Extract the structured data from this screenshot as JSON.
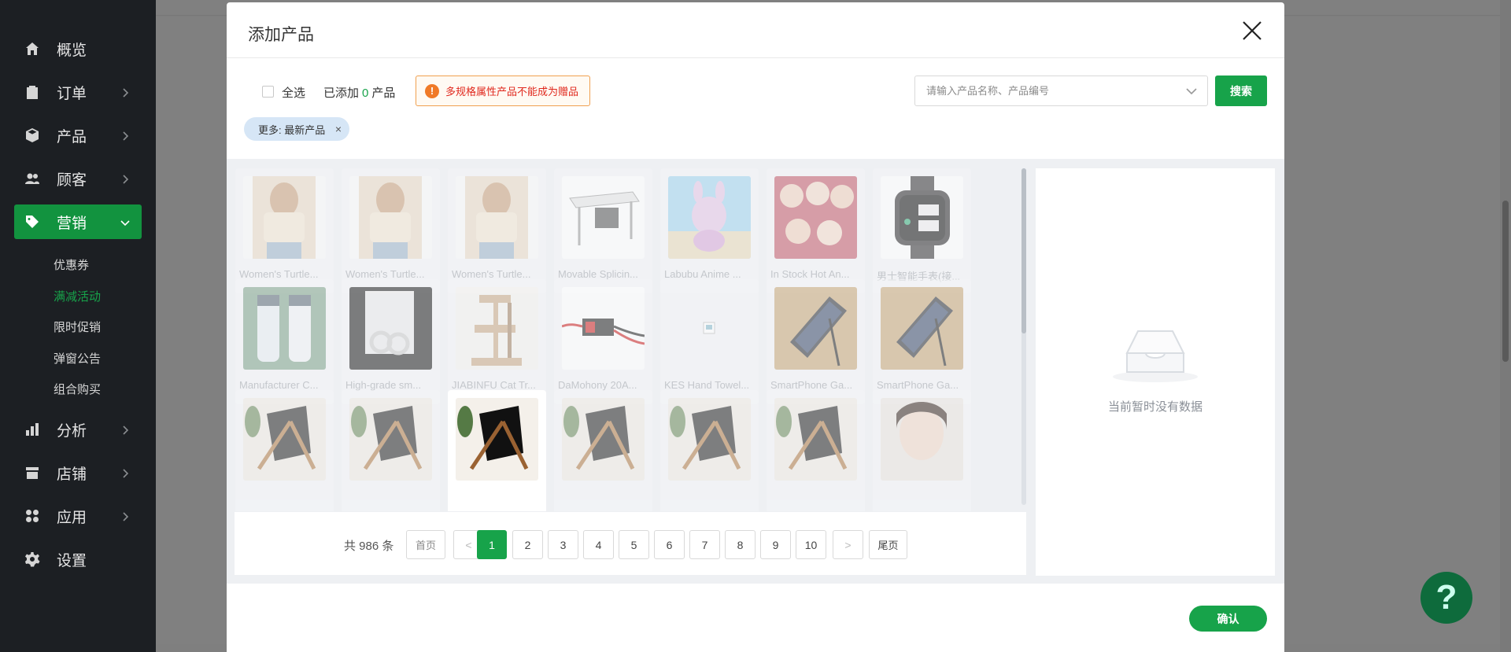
{
  "sidebar": {
    "items": [
      {
        "label": "概览",
        "icon": "home-icon"
      },
      {
        "label": "订单",
        "icon": "clipboard-icon"
      },
      {
        "label": "产品",
        "icon": "box-icon"
      },
      {
        "label": "顾客",
        "icon": "users-icon"
      },
      {
        "label": "营销",
        "icon": "tag-icon"
      },
      {
        "label": "分析",
        "icon": "bar-chart-icon"
      },
      {
        "label": "店铺",
        "icon": "store-icon"
      },
      {
        "label": "应用",
        "icon": "apps-icon"
      },
      {
        "label": "设置",
        "icon": "gear-icon"
      }
    ],
    "active": "营销",
    "marketing_subitems": [
      "优惠券",
      "满减活动",
      "限时促销",
      "弹窗公告",
      "组合购买"
    ],
    "active_subitem": "满减活动"
  },
  "modal": {
    "title": "添加产品",
    "select_all_label": "全选",
    "added_prefix": "已添加",
    "added_count": "0",
    "added_suffix": "产品",
    "warning_text": "多规格属性产品不能成为赠品",
    "search_placeholder": "请输入产品名称、产品编号",
    "search_value": "",
    "search_button": "搜索",
    "filter_tag": "更多: 最新产品",
    "filter_tag_close": "×",
    "products": [
      {
        "label": "Women's Turtle..."
      },
      {
        "label": "Women's Turtle..."
      },
      {
        "label": "Women's Turtle..."
      },
      {
        "label": "Movable Splicin..."
      },
      {
        "label": "Labubu Anime ..."
      },
      {
        "label": "In Stock Hot An..."
      },
      {
        "label": "男士智能手表(接..."
      },
      {
        "label": "Manufacturer C..."
      },
      {
        "label": "High-grade sm..."
      },
      {
        "label": "JIABINFU Cat Tr..."
      },
      {
        "label": "DaMohony 20A..."
      },
      {
        "label": "KES Hand Towel..."
      },
      {
        "label": "SmartPhone Ga..."
      },
      {
        "label": "SmartPhone Ga..."
      },
      {
        "label": ""
      },
      {
        "label": ""
      },
      {
        "label": ""
      },
      {
        "label": ""
      },
      {
        "label": ""
      },
      {
        "label": ""
      },
      {
        "label": ""
      }
    ],
    "pagination": {
      "total_text": "共 986 条",
      "first": "首页",
      "prev": "<",
      "pages": [
        "1",
        "2",
        "3",
        "4",
        "5",
        "6",
        "7",
        "8",
        "9",
        "10"
      ],
      "current": "1",
      "next": ">",
      "last": "尾页"
    },
    "empty_text": "当前暂时没有数据",
    "confirm_button": "确认"
  },
  "help_button": "?",
  "colors": {
    "primary": "#17a34a",
    "sidebar_bg": "#1c1f23",
    "warning_border": "#f0a050",
    "warning_text": "#e0281d"
  }
}
